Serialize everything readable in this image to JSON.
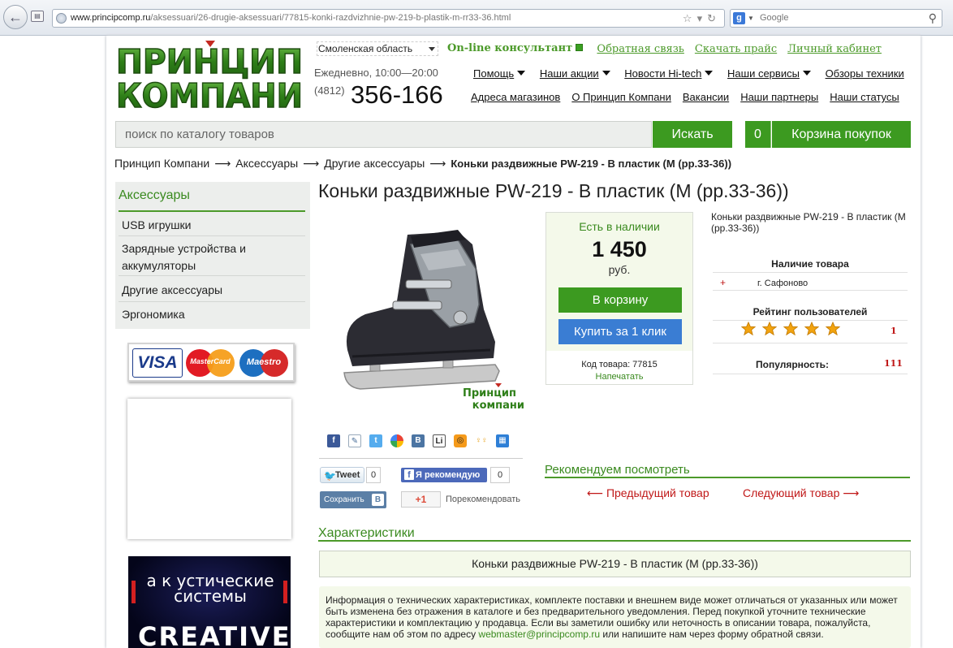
{
  "browser": {
    "url_domain": "www.principcomp.ru",
    "url_path": "/aksessuari/26-drugie-aksessuari/77815-konki-razdvizhnie-pw-219-b-plastik-m-rr33-36.html",
    "search_placeholder": "Google"
  },
  "header": {
    "logo_line1": "ПРИНЦИП",
    "logo_line2": "КОМПАНИ",
    "region": "Смоленская область",
    "consultant": "On-line консультант",
    "top_links": [
      "Обратная связь",
      "Скачать прайс",
      "Личный кабинет"
    ],
    "hours": "Ежедневно, 10:00—20:00",
    "phone_code": "(4812)",
    "phone": "356-166",
    "menu1": [
      "Помощь",
      "Наши акции",
      "Новости Hi-tech",
      "Наши сервисы",
      "Обзоры техники"
    ],
    "menu2": [
      "Адреса магазинов",
      "О Принцип Компани",
      "Вакансии",
      "Наши партнеры",
      "Наши статусы"
    ]
  },
  "search": {
    "placeholder": "поиск по каталогу товаров",
    "button": "Искать",
    "cart_count": "0",
    "cart_label": "Корзина покупок"
  },
  "breadcrumbs": {
    "items": [
      "Принцип Компани",
      "Аксессуары",
      "Другие аксессуары"
    ],
    "current": "Коньки раздвижные PW-219 - B пластик (M (рр.33-36))",
    "sep": "⟶"
  },
  "sidebar": {
    "title": "Аксессуары",
    "items": [
      "USB игрушки",
      "Зарядные устройства и аккумуляторы",
      "Другие аксессуары",
      "Эргономика"
    ],
    "cards": [
      "VISA",
      "MasterCard",
      "Maestro"
    ],
    "ad_text": "а к устические системы",
    "ad_brand": "CREATIVE"
  },
  "product": {
    "title": "Коньки раздвижные PW-219 - B пластик (M (рр.33-36))",
    "watermark_line1": "Принцип",
    "watermark_line2": "компани",
    "availability": "Есть в наличии",
    "price": "1 450",
    "currency": "руб.",
    "add_to_cart": "В корзину",
    "one_click": "Купить за 1 клик",
    "sku": "Код товара: 77815",
    "print": "Напечатать",
    "short_desc": "Коньки раздвижные PW-219 - B пластик (M (рр.33-36))",
    "stock_header": "Наличие товара",
    "stock_mark": "+",
    "stock_city": "г. Сафоново",
    "rating_header": "Рейтинг пользователей",
    "rating_stars": 5,
    "rating_count": "1",
    "popularity_label": "Популярность:",
    "popularity_value": "111"
  },
  "social": {
    "tweet": "Tweet",
    "tweet_count": "0",
    "fb_recommend": "Я рекомендую",
    "fb_count": "0",
    "vk_save": "Сохранить",
    "gplus": "+1",
    "recommend": "Порекомендовать",
    "share_icons": [
      "facebook-icon",
      "livejournal-icon",
      "twitter-icon",
      "google-icon",
      "vk-icon",
      "linkedin-icon",
      "odnoklassniki-icon",
      "mail-icon",
      "myspace-icon"
    ]
  },
  "recommend": {
    "title": "Рекомендуем посмотреть",
    "prev": "⟵ Предыдущий товар",
    "next": "Следующий товар ⟶"
  },
  "characteristics": {
    "title": "Характеристики",
    "box": "Коньки раздвижные PW-219 - B пластик (M (рр.33-36))",
    "notice": "Информация о технических характеристиках, комплекте поставки и внешнем виде может отличаться от указанных или может быть изменена без отражения в каталоге и без предварительного уведомления. Перед покупкой уточните технические характеристики и комплектацию у продавца. Если вы заметили ошибку или неточность в описании товара, пожалуйста, сообщите нам об этом по адресу ",
    "email": "webmaster@principcomp.ru",
    "notice_end": " или напишите нам через форму обратной связи."
  },
  "colors": {
    "brand_green": "#3c9a20",
    "link_green": "#3a8a1f",
    "blue_button": "#3a7dd3",
    "nav_red": "#c01818"
  }
}
